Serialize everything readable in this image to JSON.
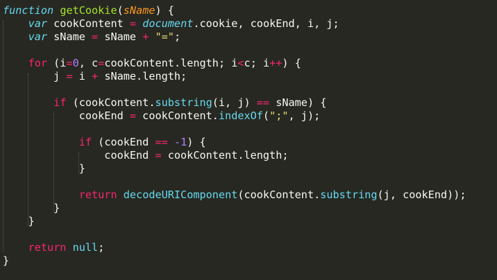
{
  "editor": {
    "theme_colors": {
      "background": "#272822",
      "text": "#f8f8f2",
      "keyword": "#f92672",
      "storage": "#66d9ef",
      "function_name": "#a6e22e",
      "parameter": "#fd971f",
      "number": "#ae81ff",
      "string": "#e6db74"
    },
    "lines": [
      [
        "function",
        " ",
        "getCookie",
        "(",
        "sName",
        ") {"
      ],
      [
        "    ",
        "var",
        " cookContent ",
        "=",
        " ",
        "document",
        ".cookie, cookEnd, i, j;"
      ],
      [
        "    ",
        "var",
        " sName ",
        "=",
        " sName ",
        "+",
        " ",
        "\"=\"",
        ";"
      ],
      [
        ""
      ],
      [
        "    ",
        "for",
        " (i",
        "=",
        "0",
        ", c",
        "=",
        "cookContent.length; i",
        "<",
        "c; i",
        "++",
        ") {"
      ],
      [
        "        j ",
        "=",
        " i ",
        "+",
        " sName.length;"
      ],
      [
        ""
      ],
      [
        "        ",
        "if",
        " (cookContent.",
        "substring",
        "(i, j) ",
        "==",
        " sName) {"
      ],
      [
        "            cookEnd ",
        "=",
        " cookContent.",
        "indexOf",
        "(",
        "\";\"",
        ", j);"
      ],
      [
        ""
      ],
      [
        "            ",
        "if",
        " (cookEnd ",
        "==",
        " ",
        "-1",
        ") {"
      ],
      [
        "                cookEnd ",
        "=",
        " cookContent.length;"
      ],
      [
        "            }"
      ],
      [
        ""
      ],
      [
        "            ",
        "return",
        " ",
        "decodeURIComponent",
        "(cookContent.",
        "substring",
        "(j, cookEnd));"
      ],
      [
        "        }"
      ],
      [
        "    }"
      ],
      [
        ""
      ],
      [
        "    ",
        "return",
        " ",
        "null",
        ";"
      ],
      [
        "}"
      ]
    ]
  }
}
